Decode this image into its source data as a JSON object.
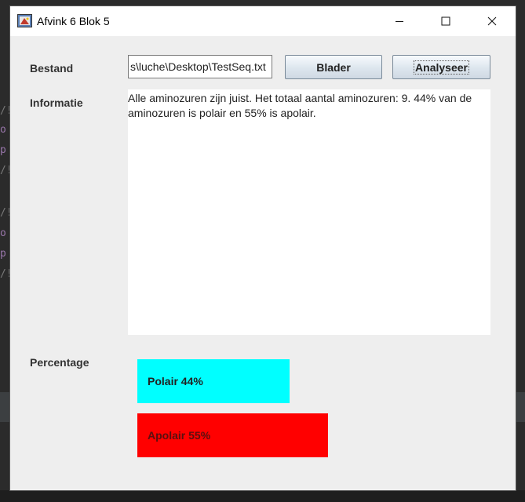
{
  "window": {
    "title": "Afvink 6 Blok 5"
  },
  "form": {
    "bestand_label": "Bestand",
    "file_path": "s\\luche\\Desktop\\TestSeq.txt",
    "blader_button": "Blader",
    "analyseer_button": "Analyseer",
    "informatie_label": "Informatie",
    "informatie_text": "Alle aminozuren zijn juist. Het totaal aantal aminozuren: 9. 44% van de aminozuren is polair en 55% is apolair.",
    "percentage_label": "Percentage"
  },
  "bars": [
    {
      "label": "Polair 44%",
      "value_percent": 44,
      "color": "#00ffff"
    },
    {
      "label": "Apolair 55%",
      "value_percent": 55,
      "color": "#ff0000"
    }
  ],
  "icons": {
    "app": "app-icon",
    "minimize": "minimize-icon",
    "maximize": "maximize-icon",
    "close": "close-icon"
  }
}
